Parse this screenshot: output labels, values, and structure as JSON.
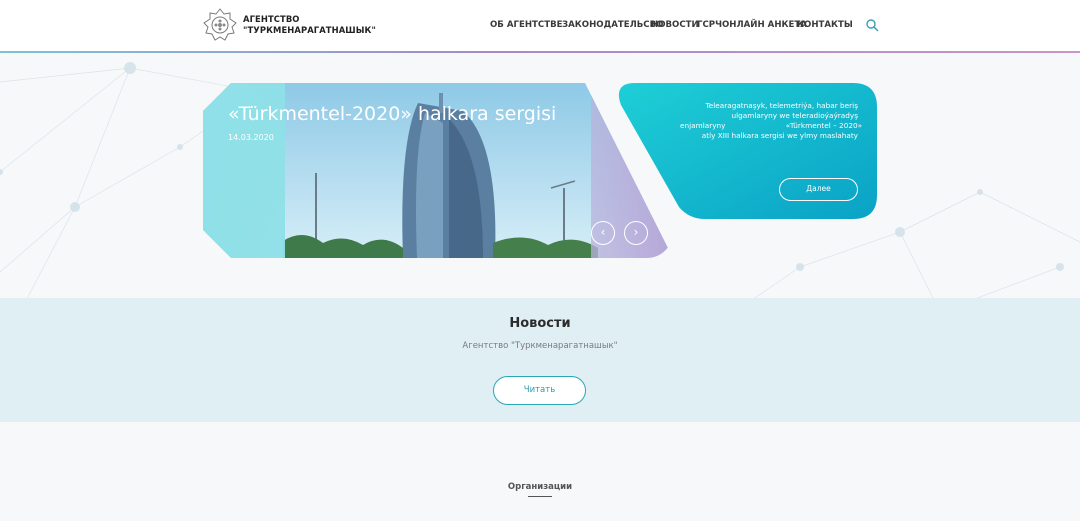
{
  "header": {
    "logo_alt": "agency-emblem",
    "logo_line1": "АГЕНТСТВО",
    "logo_line2": "\"ТУРКМЕНАРАГАТНАШЫК\"",
    "nav": [
      {
        "label": "ОБ АГЕНТСТВЕ"
      },
      {
        "label": "ЗАКОНОДАТЕЛЬСВО"
      },
      {
        "label": "НОВОСТИ"
      },
      {
        "label": "ГСРЧ"
      },
      {
        "label": "ОНЛАЙН АНКЕТА"
      },
      {
        "label": "КОНТАКТЫ"
      }
    ],
    "search_icon": "search-icon"
  },
  "slider": {
    "title": "«Türkmentel-2020» halkara sergisi",
    "date": "14.03.2020",
    "prev_icon": "chevron-left-icon",
    "next_icon": "chevron-right-icon",
    "prev_glyph": "‹",
    "next_glyph": "›",
    "description_lines": [
      "Telearagatnaşyk, telemetriýa, habar beriş",
      "ulgamlaryny we teleradioýaýradyş",
      "enjamlaryny                          «Türkmentel – 2020»",
      "atly XIII halkara sergisi we ylmy maslahaty"
    ],
    "more_label": "Далее"
  },
  "news": {
    "title": "Новости",
    "subtitle": "Агентство \"Туркменарагатнашык\"",
    "read_label": "Читать"
  },
  "organizations": {
    "title": "Организации"
  },
  "colors": {
    "accent": "#2aa8b6",
    "teal_card": "#12b6cc",
    "news_band": "#dfeff4"
  }
}
